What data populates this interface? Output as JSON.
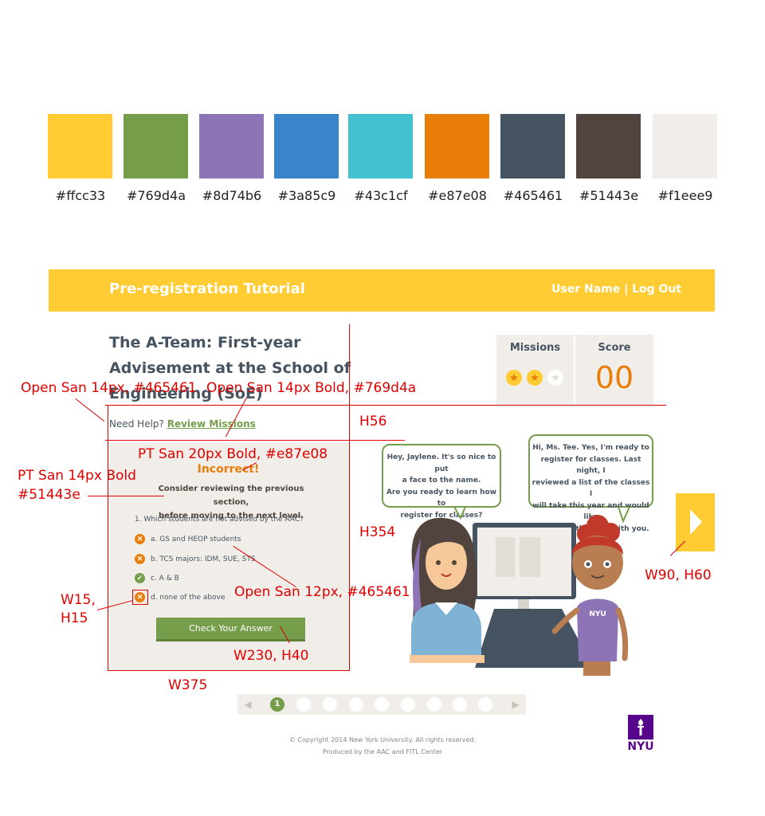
{
  "palette": [
    {
      "hex": "#ffcc33",
      "label": "#ffcc33"
    },
    {
      "hex": "#769d4a",
      "label": "#769d4a"
    },
    {
      "hex": "#8d74b6",
      "label": "#8d74b6"
    },
    {
      "hex": "#3a85c9",
      "label": "#3a85c9"
    },
    {
      "hex": "#43c1cf",
      "label": "#43c1cf"
    },
    {
      "hex": "#e87e08",
      "label": "#e87e08"
    },
    {
      "hex": "#465461",
      "label": "#465461"
    },
    {
      "hex": "#51443e",
      "label": "#51443e"
    },
    {
      "hex": "#f1eee9",
      "label": "#f1eee9"
    }
  ],
  "header": {
    "title": "Pre-registration Tutorial",
    "user_name": "User Name",
    "separator": " | ",
    "logout": "Log Out"
  },
  "page": {
    "title": "The A-Team: First-year Advisement at the School of Engineering (SoE)"
  },
  "status": {
    "missions_label": "Missions",
    "missions_earned": 2,
    "missions_total": 3,
    "score_label": "Score",
    "score_value": "00"
  },
  "help": {
    "prefix": "Need Help? ",
    "link": "Review Missions"
  },
  "quiz": {
    "result": "Incorrect!",
    "advice_line1": "Consider reviewing the previous section,",
    "advice_line2": "before moving to the next level.",
    "question": "1. Which students are not advised by the AAC?",
    "options": [
      {
        "text": "a. GS and HEOP students",
        "state": "wrong"
      },
      {
        "text": "b. TCS majors: IDM, SUE, STS",
        "state": "wrong"
      },
      {
        "text": "c.  A & B",
        "state": "right"
      },
      {
        "text": "d. none of the above",
        "state": "wrong"
      }
    ],
    "check_button": "Check Your Answer"
  },
  "dialogue": {
    "advisor_lines": [
      "Hey, Jaylene. It's so nice to put",
      "a face to the name.",
      "Are you ready to learn how to",
      "register for classes?"
    ],
    "student_lines": [
      "Hi, Ms. Tee. Yes, I'm ready to",
      "register for classes. Last night, I",
      "reviewed a list of the classes I",
      "will take this year and would like",
      "to discuss this info with you."
    ],
    "shirt_text": "NYU"
  },
  "pagination": {
    "current": "1",
    "total_pages": 9
  },
  "footer": {
    "line1": "© Copyright 2014 New York University. All rights reserved.",
    "line2": "Produced by the AAC and FITL Center",
    "logo_text": "NYU"
  },
  "annotations": {
    "help_font": "Open San 14px, #465461",
    "link_font": "Open San 14px Bold, #769d4a",
    "help_height": "H56",
    "result_font": "PT San 20px Bold, #e87e08",
    "advice_font_1": "PT San 14px Bold",
    "advice_font_2": "#51443e",
    "panel_height": "H354",
    "option_font": "Open San 12px, #465461",
    "icon_size_1": "W15,",
    "icon_size_2": "H15",
    "button_size": "W230, H40",
    "panel_width": "W375",
    "next_size": "W90, H60"
  }
}
